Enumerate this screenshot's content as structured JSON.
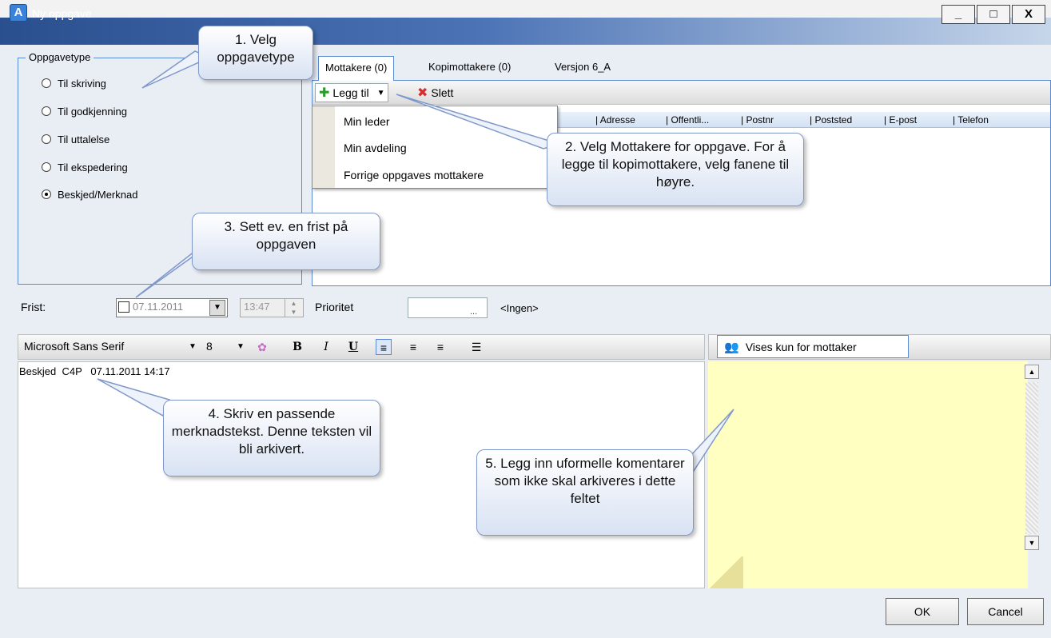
{
  "window": {
    "title": "Ny oppgave",
    "minimize": "_",
    "maximize": "□",
    "close": "X"
  },
  "oppgavetype": {
    "legend": "Oppgavetype",
    "options": [
      {
        "label": "Til skriving",
        "selected": false
      },
      {
        "label": "Til godkjenning",
        "selected": false
      },
      {
        "label": "Til uttalelse",
        "selected": false
      },
      {
        "label": "Til ekspedering",
        "selected": false
      },
      {
        "label": "Beskjed/Merknad",
        "selected": true
      }
    ]
  },
  "tabs": [
    {
      "label": "Mottakere (0)",
      "active": true
    },
    {
      "label": "Kopimottakere (0)",
      "active": false
    },
    {
      "label": "Versjon 6_A",
      "active": false
    }
  ],
  "recipients_toolbar": {
    "add_label": "Legg til",
    "delete_label": "Slett"
  },
  "columns": [
    "Adresse",
    "Offentli...",
    "Postnr",
    "Poststed",
    "E-post",
    "Telefon"
  ],
  "add_menu": [
    "Min leder",
    "Min avdeling",
    "Forrige oppgaves mottakere"
  ],
  "frist": {
    "label": "Frist:",
    "date": "07.11.2011",
    "time": "13:47",
    "checked": false
  },
  "prioritet": {
    "label": "Prioritet",
    "value": "",
    "browse": "...",
    "display": "<Ingen>"
  },
  "editor": {
    "font_name": "Microsoft Sans Serif",
    "font_size": "8",
    "text": "Beskjed  C4P   07.11.2011 14:17"
  },
  "note": {
    "button_label": "Vises kun for mottaker",
    "color": "#ffffc1"
  },
  "buttons": {
    "ok": "OK",
    "cancel": "Cancel"
  },
  "callouts": {
    "c1": "1. Velg oppgavetype",
    "c2": "2. Velg Mottakere for oppgave. For å legge til kopimottakere, velg fanene til høyre.",
    "c3": "3. Sett ev. en frist på oppgaven",
    "c4": "4. Skriv en passende merknadstekst. Denne teksten vil bli arkivert.",
    "c5": "5. Legg inn uformelle komentarer som ikke skal arkiveres i dette feltet"
  }
}
